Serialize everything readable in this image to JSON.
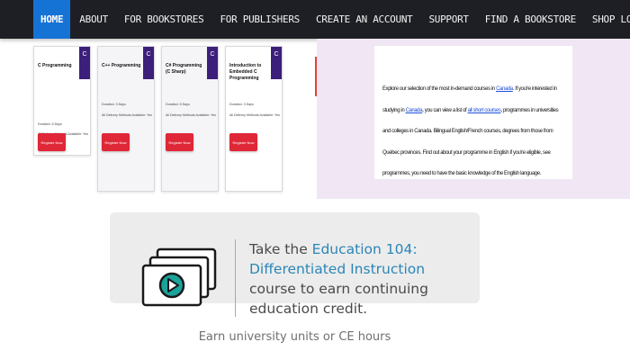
{
  "nav": {
    "items": [
      "HOME",
      "ABOUT",
      "FOR BOOKSTORES",
      "FOR PUBLISHERS",
      "CREATE AN ACCOUNT",
      "SUPPORT",
      "FIND A BOOKSTORE",
      "SHOP LOCAL"
    ],
    "active": "HOME"
  },
  "cards": [
    {
      "title": "C Programming",
      "badge": "C",
      "meta1": "Duration: 5 Days",
      "meta2": "All Delivery Methods Available: Yes",
      "register": "Register Now"
    },
    {
      "title": "C++ Programming",
      "badge": "C",
      "meta1": "Duration: 3 Days",
      "meta2": "All Delivery Methods Available: Yes",
      "register": "Register Now"
    },
    {
      "title": "C# Programming (C Sharp)",
      "badge": "C",
      "meta1": "Duration: 5 Days",
      "meta2": "All Delivery Methods Available: Yes",
      "register": "Register Now"
    },
    {
      "title": "Introduction to Embedded C Programming",
      "badge": "C",
      "meta1": "Duration: 3 Days",
      "meta2": "All Delivery Methods Available: Yes",
      "register": "Register Now"
    }
  ],
  "panel": {
    "before1": "Explore our selection of the most in-demand courses in ",
    "link1": "Canada",
    "mid": ". If you're interested in studying in ",
    "link2": "Canada",
    "mid2": ", you can view a list of ",
    "link3": "all short courses",
    "after": ", programmes in universities and colleges in Canada. Bilingual English/French courses, degrees from those from Quebec provinces. Find out about your programme in English if you're eligible, see programmes, you need to have the basic knowledge of the English language."
  },
  "promo": {
    "prefix": "Take the ",
    "course": "Education 104: Differentiated Instruction",
    "suffix": " course to earn continuing education credit.",
    "footnote": "Earn university units or CE hours"
  },
  "colors": {
    "nav_bg": "#1e1f24",
    "nav_active": "#1573d6",
    "badge": "#3b1f7a",
    "register": "#e02737",
    "lavender": "#f0e6f4",
    "course_link": "#2a86b8",
    "play_icon": "#1aa39c"
  },
  "icons": {
    "promo": "video-course-icon",
    "badge": "c-language-icon"
  }
}
